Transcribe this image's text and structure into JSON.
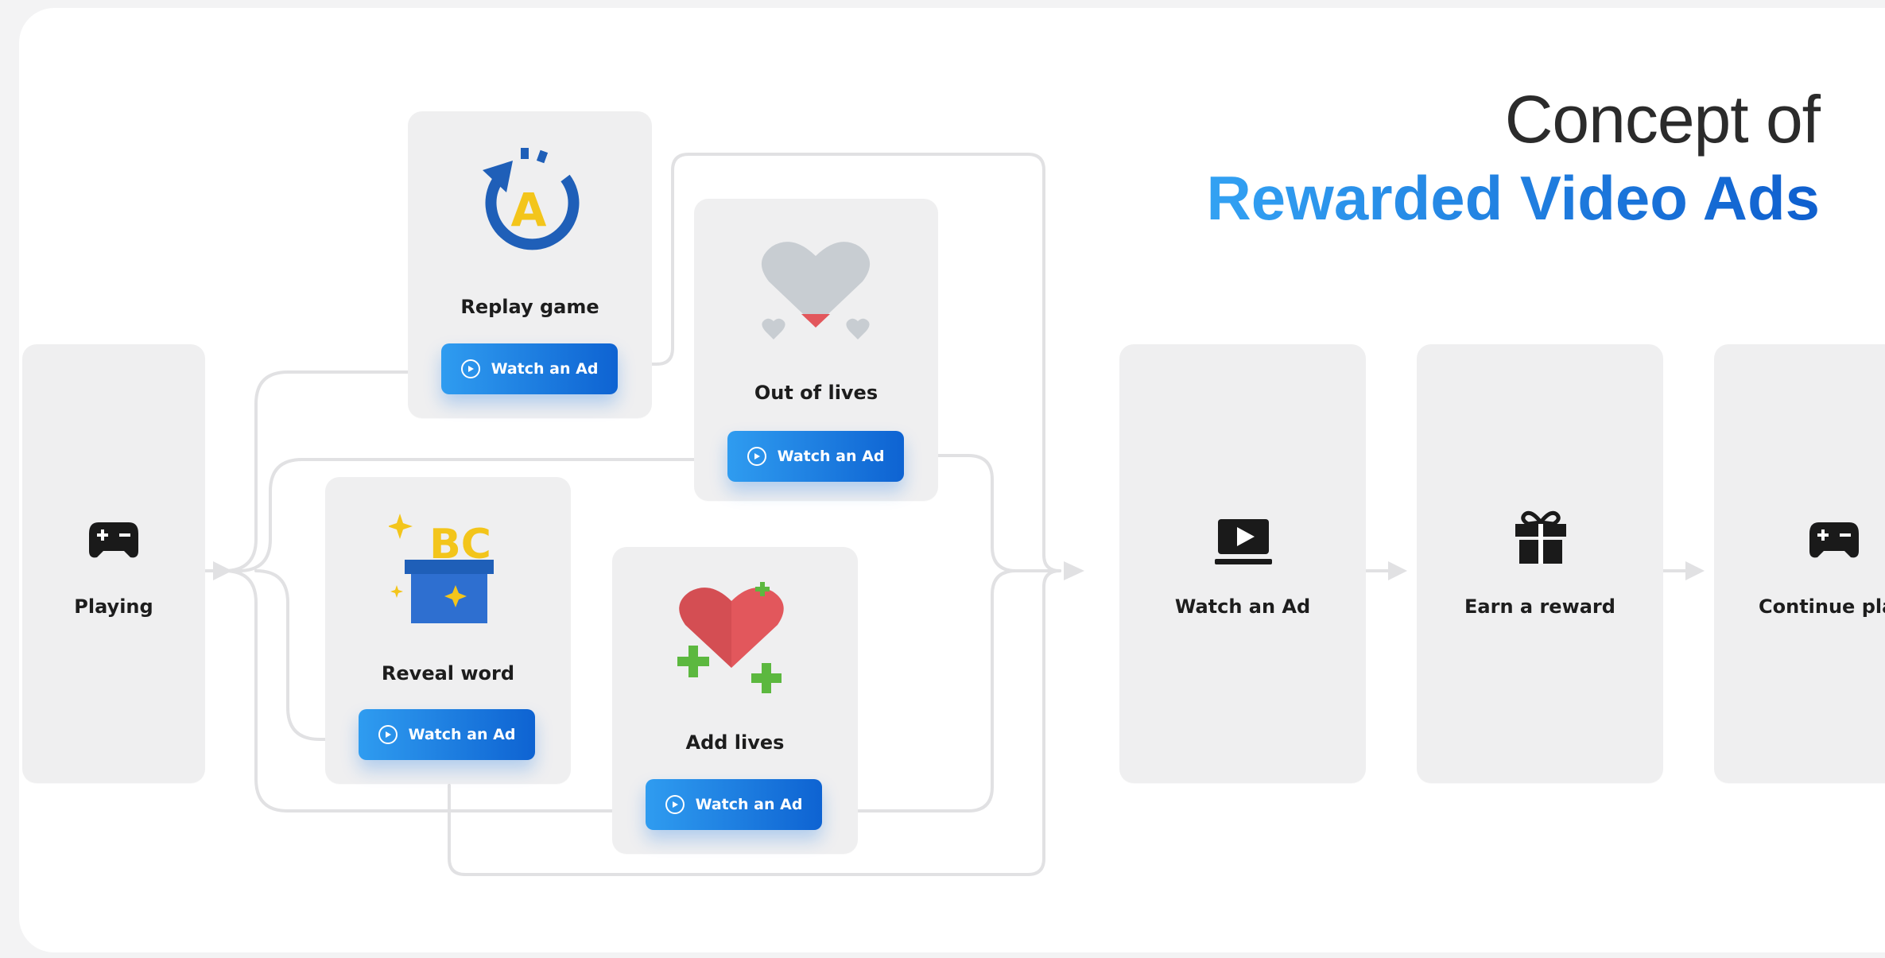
{
  "title": {
    "line1": "Concept of",
    "line2": "Rewarded Video Ads"
  },
  "start_node": {
    "label": "Playing",
    "icon": "gamepad-icon"
  },
  "options": [
    {
      "id": "replay",
      "label": "Replay game",
      "icon": "replay-icon",
      "button": "Watch an Ad"
    },
    {
      "id": "out_of_lives",
      "label": "Out of lives",
      "icon": "broken-heart-icon",
      "button": "Watch an Ad"
    },
    {
      "id": "reveal",
      "label": "Reveal word",
      "icon": "magic-box-icon",
      "button": "Watch an Ad"
    },
    {
      "id": "add_lives",
      "label": "Add lives",
      "icon": "heart-plus-icon",
      "button": "Watch an Ad"
    }
  ],
  "flow": [
    {
      "label": "Watch an Ad",
      "icon": "video-play-icon"
    },
    {
      "label": "Earn a reward",
      "icon": "gift-icon"
    },
    {
      "label": "Continue playing",
      "icon": "gamepad-icon"
    }
  ],
  "colors": {
    "accent_start": "#2f9cf0",
    "accent_end": "#0e63d2",
    "card_bg": "#efeff0",
    "connector": "#e2e2e4",
    "heart_red": "#e2575c",
    "plus_green": "#5cb83f",
    "box_blue": "#1f5fb8",
    "star_yellow": "#f3c51b"
  }
}
